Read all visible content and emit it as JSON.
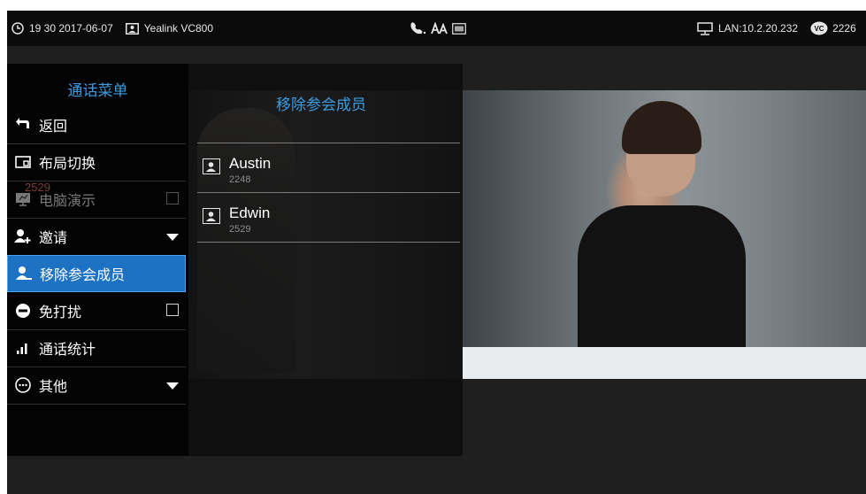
{
  "status_bar": {
    "time": "19 30 2017-06-07",
    "device": "Yealink VC800",
    "lan": "LAN:10.2.20.232",
    "vc_number": "2226"
  },
  "call_menu": {
    "title": "通话菜单",
    "items": [
      {
        "label": "返回",
        "icon": "back-arrow-icon"
      },
      {
        "label": "布局切换",
        "icon": "layout-icon"
      },
      {
        "label": "电脑演示",
        "icon": "presentation-icon",
        "disabled": true,
        "checkbox": false
      },
      {
        "label": "邀请",
        "icon": "invite-icon",
        "has_dropdown": true
      },
      {
        "label": "移除参会成员",
        "icon": "remove-member-icon",
        "selected": true
      },
      {
        "label": "免打扰",
        "icon": "dnd-icon",
        "checkbox": false
      },
      {
        "label": "通话统计",
        "icon": "signal-bars-icon"
      },
      {
        "label": "其他",
        "icon": "more-icon",
        "has_dropdown": true
      }
    ],
    "ghost_number": "2529"
  },
  "remove_members": {
    "title": "移除参会成员",
    "members": [
      {
        "name": "Austin",
        "number": "2248"
      },
      {
        "name": "Edwin",
        "number": "2529"
      }
    ]
  },
  "colors": {
    "accent": "#3d9be0",
    "selected_bg": "#1d72c4",
    "status_bar_bg": "#0b0b0b"
  }
}
